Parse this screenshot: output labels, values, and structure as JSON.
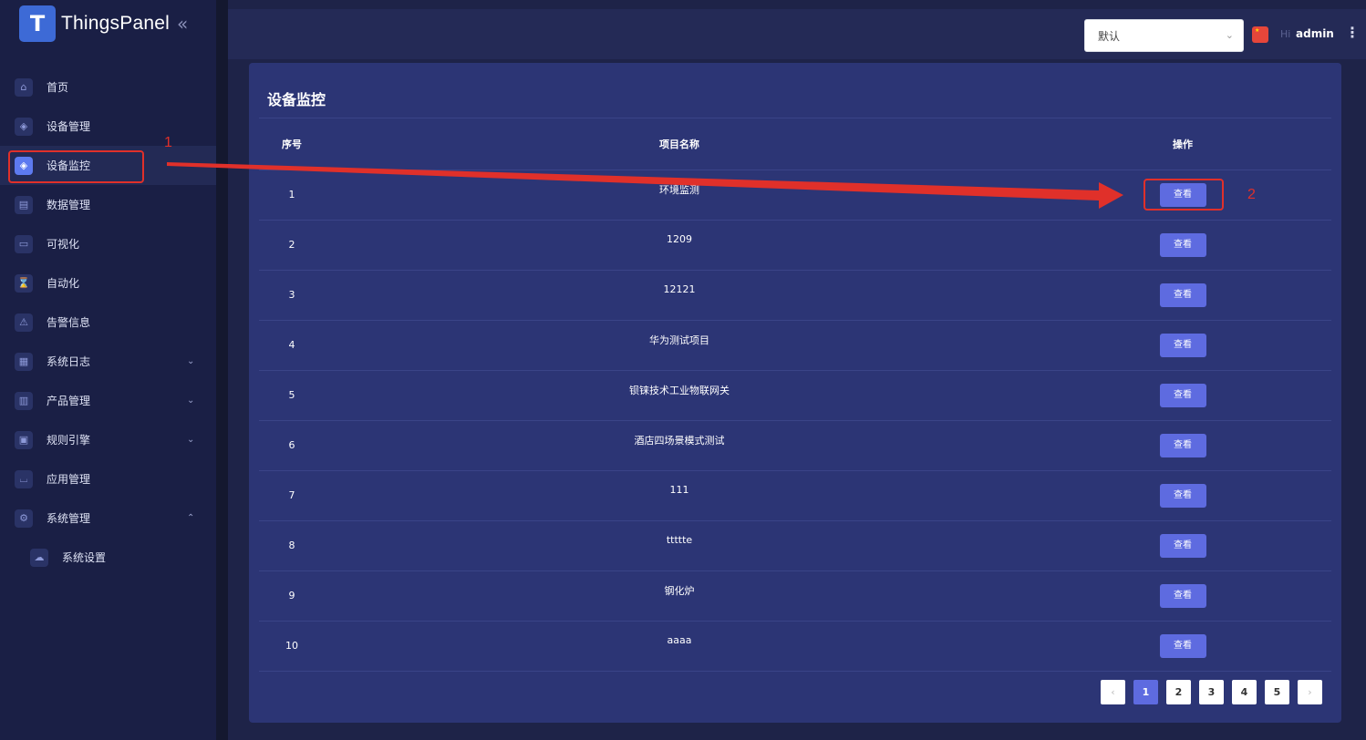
{
  "app": {
    "logo_letter": "T",
    "name": "ThingsPanel"
  },
  "sidebar": {
    "items": [
      {
        "label": "首页",
        "icon": "home-icon",
        "glyph": "⌂"
      },
      {
        "label": "设备管理",
        "icon": "device-icon",
        "glyph": "◈"
      },
      {
        "label": "设备监控",
        "icon": "monitor-icon",
        "glyph": "◈",
        "active": true
      },
      {
        "label": "数据管理",
        "icon": "data-icon",
        "glyph": "▤"
      },
      {
        "label": "可视化",
        "icon": "chart-icon",
        "glyph": "▭"
      },
      {
        "label": "自动化",
        "icon": "automation-icon",
        "glyph": "⌛"
      },
      {
        "label": "告警信息",
        "icon": "warning-icon",
        "glyph": "⚠"
      },
      {
        "label": "系统日志",
        "icon": "log-icon",
        "glyph": "▦",
        "caret": "⌄"
      },
      {
        "label": "产品管理",
        "icon": "product-icon",
        "glyph": "▥",
        "caret": "⌄"
      },
      {
        "label": "规则引擎",
        "icon": "gift-icon",
        "glyph": "▣",
        "caret": "⌄"
      },
      {
        "label": "应用管理",
        "icon": "basket-icon",
        "glyph": "⌴"
      },
      {
        "label": "系统管理",
        "icon": "gear-icon",
        "glyph": "⚙",
        "caret": "⌃"
      }
    ],
    "subitems": [
      {
        "label": "系统设置",
        "icon": "cloud-icon",
        "glyph": "☁"
      }
    ]
  },
  "header": {
    "select_value": "默认",
    "greeting": "Hi",
    "username": "admin"
  },
  "card": {
    "title": "设备监控",
    "columns": [
      "序号",
      "项目名称",
      "操作"
    ],
    "rows": [
      {
        "index": "1",
        "name": "环境监测",
        "action": "查看"
      },
      {
        "index": "2",
        "name": "1209",
        "action": "查看"
      },
      {
        "index": "3",
        "name": "12121",
        "action": "查看"
      },
      {
        "index": "4",
        "name": "华为测试项目",
        "action": "查看"
      },
      {
        "index": "5",
        "name": "钡铼技术工业物联网关",
        "action": "查看"
      },
      {
        "index": "6",
        "name": "酒店四场景模式测试",
        "action": "查看"
      },
      {
        "index": "7",
        "name": "111",
        "action": "查看"
      },
      {
        "index": "8",
        "name": "ttttte",
        "action": "查看"
      },
      {
        "index": "9",
        "name": "钢化炉",
        "action": "查看"
      },
      {
        "index": "10",
        "name": "aaaa",
        "action": "查看"
      }
    ]
  },
  "pagination": {
    "prev": "‹",
    "next": "›",
    "pages": [
      "1",
      "2",
      "3",
      "4",
      "5"
    ],
    "current": "1"
  },
  "annotations": {
    "label_1": "1",
    "label_2": "2"
  },
  "colors": {
    "accent": "#5e6be0",
    "annotation": "#e0302a",
    "card_bg": "#2c3575",
    "page_bg": "#1e2348"
  }
}
